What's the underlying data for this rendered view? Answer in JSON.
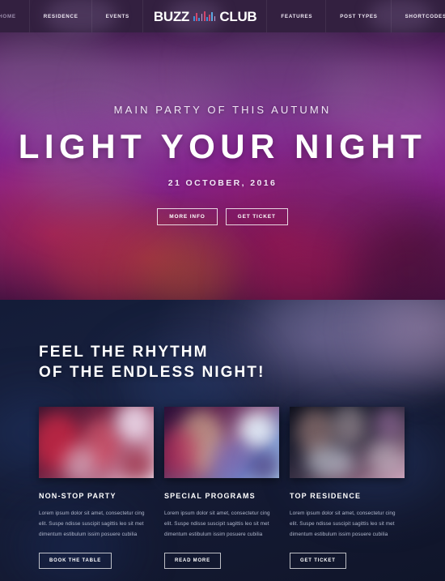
{
  "nav": {
    "left_items": [
      {
        "label": "Home",
        "active": true
      },
      {
        "label": "Residence",
        "active": false
      },
      {
        "label": "Events",
        "active": false
      }
    ],
    "logo": {
      "word1": "BUZZ",
      "word2": "CLUB",
      "icon": "equalizer-icon"
    },
    "right_items": [
      {
        "label": "Features"
      },
      {
        "label": "Post Types"
      },
      {
        "label": "Shortcodes"
      }
    ],
    "bg_color": "#332040"
  },
  "hero": {
    "kicker": "MAIN PARTY OF THIS AUTUMN",
    "headline": "LIGHT YOUR NIGHT",
    "date": "21 OCTOBER, 2016",
    "buttons": [
      {
        "label": "MORE INFO"
      },
      {
        "label": "GET TICKET"
      }
    ]
  },
  "features": {
    "title_line1": "FEEL THE RHYTHM",
    "title_line2": "OF THE ENDLESS NIGHT!",
    "cards": [
      {
        "image": "dancing-crowd-photo",
        "title": "NON-STOP PARTY",
        "text": "Lorem ipsum dolor sit amet, consectetur cing elit. Suspe ndisse suscipit sagittis leo sit met dimentum estibulum issim posuere cubilia",
        "button": "BOOK THE TABLE"
      },
      {
        "image": "dancing-woman-photo",
        "title": "SPECIAL PROGRAMS",
        "text": "Lorem ipsum dolor sit amet, consectetur cing elit. Suspe ndisse suscipit sagittis leo sit met dimentum estibulum issim posuere cubilia",
        "button": "READ MORE"
      },
      {
        "image": "dj-mixer-photo",
        "title": "TOP RESIDENCE",
        "text": "Lorem ipsum dolor sit amet, consectetur cing elit. Suspe ndisse suscipit sagittis leo sit met dimentum estibulum issim posuere cubilia",
        "button": "GET TICKET"
      }
    ]
  }
}
